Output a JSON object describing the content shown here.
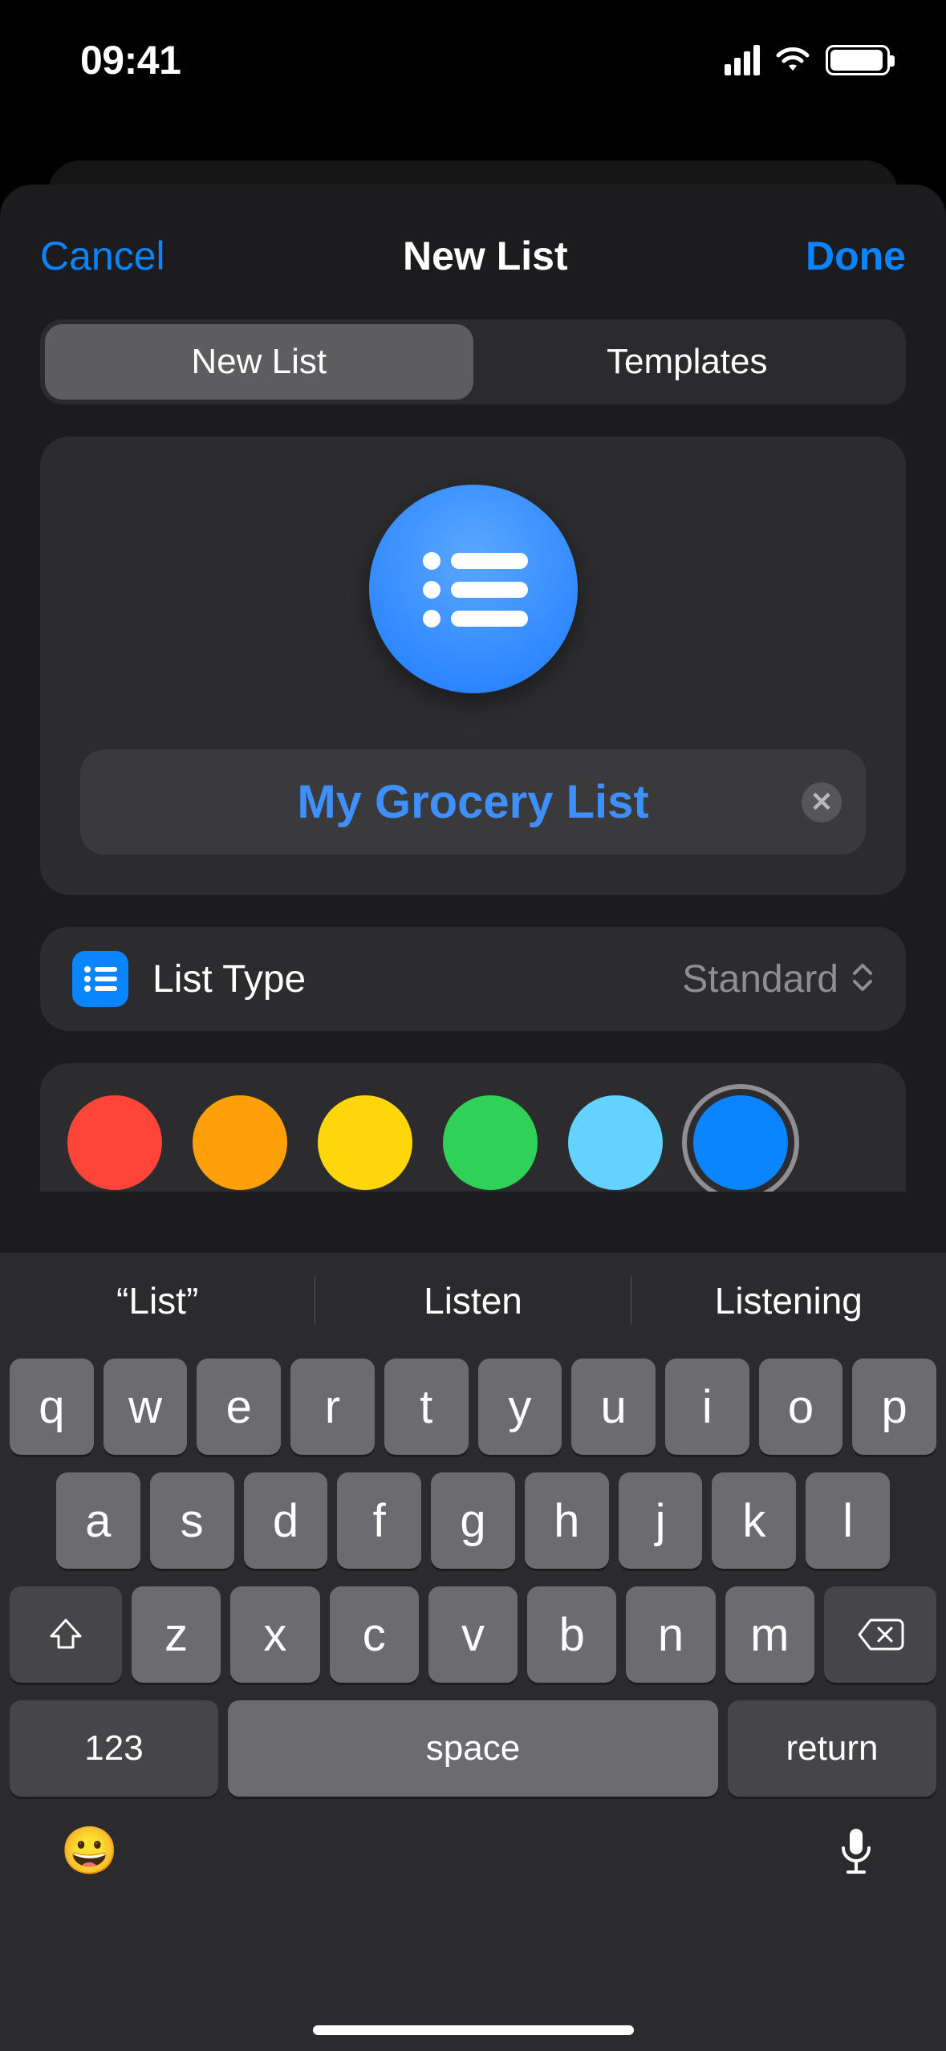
{
  "statusBar": {
    "time": "09:41"
  },
  "nav": {
    "cancel": "Cancel",
    "title": "New List",
    "done": "Done"
  },
  "segmented": {
    "newList": "New List",
    "templates": "Templates"
  },
  "listName": {
    "value": "My Grocery List"
  },
  "listType": {
    "label": "List Type",
    "value": "Standard"
  },
  "colors": {
    "swatches": [
      "#ff453a",
      "#ff9f0a",
      "#ffd60a",
      "#30d158",
      "#64d2ff",
      "#0a84ff"
    ],
    "selectedIndex": 5
  },
  "keyboard": {
    "suggestions": [
      "“List”",
      "Listen",
      "Listening"
    ],
    "row1": [
      "q",
      "w",
      "e",
      "r",
      "t",
      "y",
      "u",
      "i",
      "o",
      "p"
    ],
    "row2": [
      "a",
      "s",
      "d",
      "f",
      "g",
      "h",
      "j",
      "k",
      "l"
    ],
    "row3": [
      "z",
      "x",
      "c",
      "v",
      "b",
      "n",
      "m"
    ],
    "numKey": "123",
    "space": "space",
    "return": "return"
  }
}
